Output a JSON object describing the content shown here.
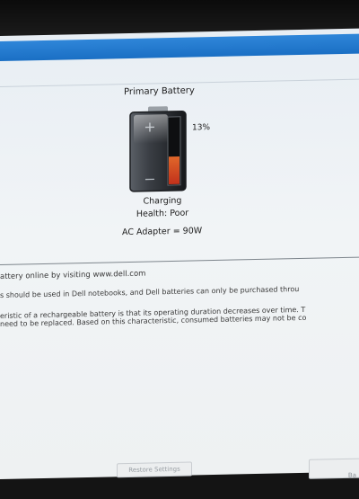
{
  "battery": {
    "title": "Primary Battery",
    "charge_percent_label": "13%",
    "charge_level": 0.13,
    "status": "Charging",
    "health": "Health: Poor",
    "adapter": "AC Adapter = 90W",
    "plus_glyph": "+",
    "minus_glyph": "−",
    "colors": {
      "level_top": "#e0672a",
      "level_bottom": "#c2311b"
    }
  },
  "info": {
    "line1": "attery online by visiting www.dell.com",
    "line2": "s should be used in Dell notebooks, and Dell batteries can only be purchased throu",
    "line3": "eristic of a rechargeable battery is that its operating duration decreases over time. T",
    "line4": "need to be replaced.  Based on this characteristic, consumed batteries may not be co"
  },
  "buttons": {
    "restore": "Restore Settings",
    "right_partial": "Ba"
  }
}
